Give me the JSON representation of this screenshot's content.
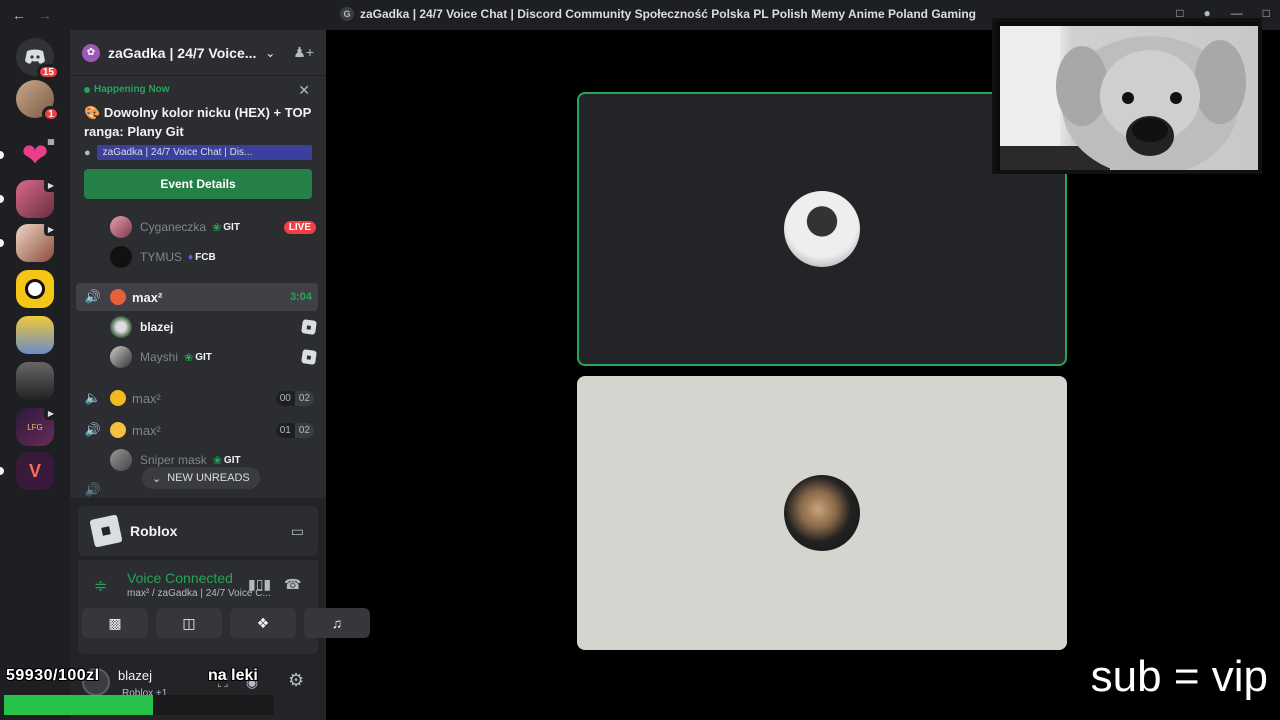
{
  "window": {
    "title": "zaGadka | 24/7 Voice Chat | Discord Community Społeczność Polska PL Polish Memy Anime Poland Gaming",
    "title_icon": "G"
  },
  "guilds": {
    "home_badge": "15",
    "dm_badge": "1"
  },
  "server": {
    "name": "zaGadka | 24/7 Voice..."
  },
  "event": {
    "status": "Happening Now",
    "title": "Dowolny kolor nicku (HEX) + TOP ranga: Plany Git",
    "location": "zaGadka | 24/7 Voice Chat | Dis...",
    "button": "Event Details"
  },
  "voice_channels": {
    "users_top": [
      {
        "name": "Cyganeczka",
        "tag": "GIT",
        "live": "LIVE"
      },
      {
        "name": "TYMUS",
        "tag": "FCB"
      }
    ],
    "active_channel": {
      "name": "max²",
      "timer": "3:04"
    },
    "active_users": [
      {
        "name": "blazej"
      },
      {
        "name": "Mayshi",
        "tag": "GIT"
      }
    ],
    "channel_a": {
      "name": "max²",
      "count_a": "00",
      "count_b": "02"
    },
    "channel_b": {
      "name": "max²",
      "count_a": "01",
      "count_b": "02"
    },
    "user_sniper": {
      "name": "Sniper mask",
      "tag": "GIT"
    },
    "new_unreads": "NEW UNREADS"
  },
  "activity": {
    "name": "Roblox"
  },
  "voice": {
    "status": "Voice Connected",
    "subtitle": "max² / zaGadka | 24/7 Voice C..."
  },
  "user": {
    "name": "blazej",
    "status": "Roblox +1"
  },
  "overlay": {
    "counter": "59930/100zl",
    "right_text": "na leki",
    "progress_fraction": 0.55,
    "sub_text": "sub = vip"
  },
  "colors": {
    "green": "#23a55a",
    "red": "#f23f43",
    "bg": "#000000"
  }
}
